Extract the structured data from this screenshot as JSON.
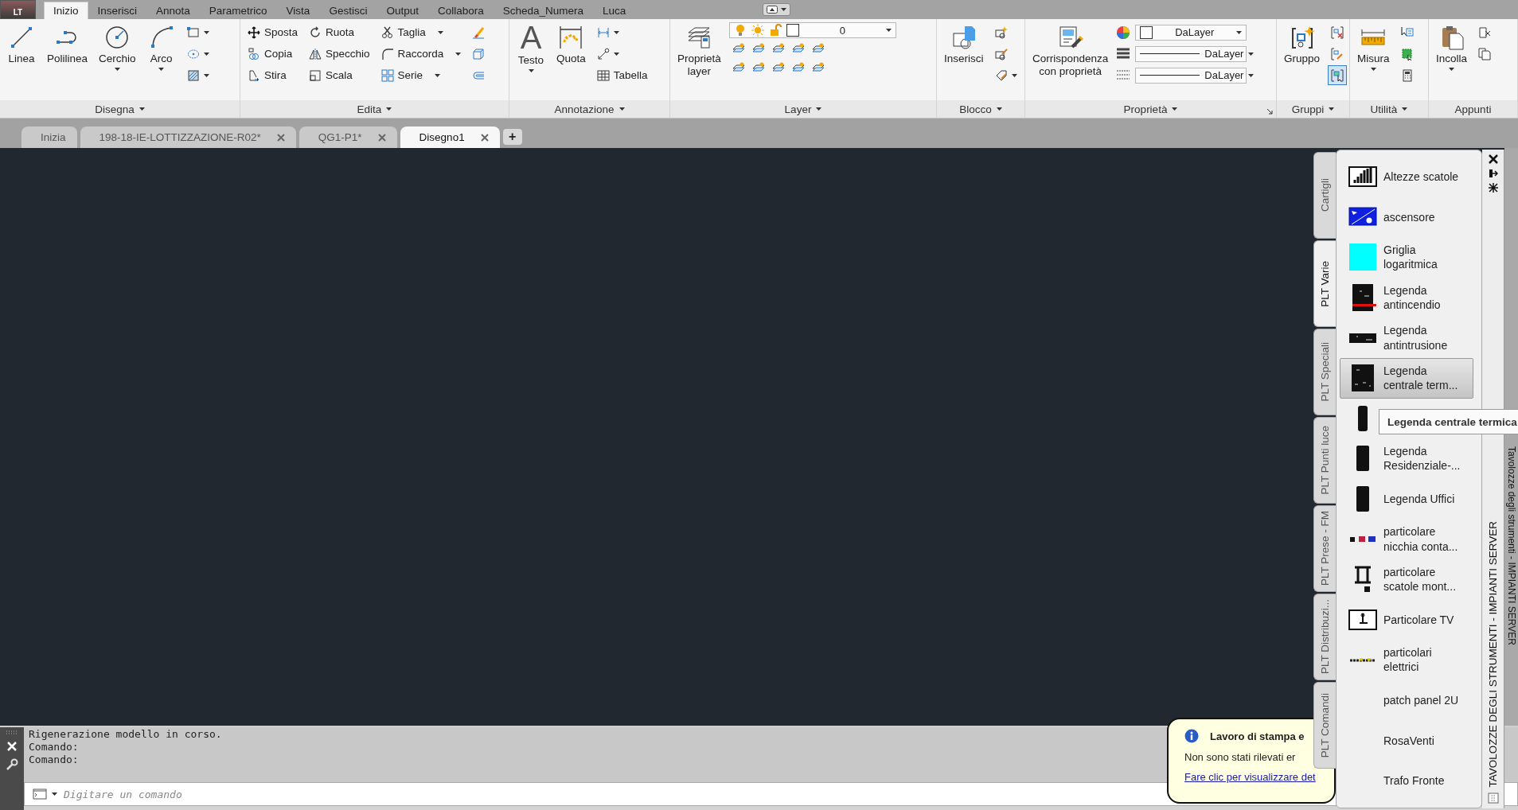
{
  "app_button": {
    "label": "LT"
  },
  "ribbon_tabs": [
    {
      "label": "Inizio",
      "selected": true
    },
    {
      "label": "Inserisci",
      "selected": false
    },
    {
      "label": "Annota",
      "selected": false
    },
    {
      "label": "Parametrico",
      "selected": false
    },
    {
      "label": "Vista",
      "selected": false
    },
    {
      "label": "Gestisci",
      "selected": false
    },
    {
      "label": "Output",
      "selected": false
    },
    {
      "label": "Collabora",
      "selected": false
    },
    {
      "label": "Scheda_Numera",
      "selected": false
    },
    {
      "label": "Luca",
      "selected": false
    }
  ],
  "ribbon_panels": [
    {
      "title": "Disegna",
      "menu": true,
      "launcher": false,
      "columns": [
        [
          {
            "kind": "large",
            "label": "Linea",
            "dropdown": false
          }
        ],
        [
          {
            "kind": "large",
            "label": "Polilinea",
            "dropdown": false
          }
        ],
        [
          {
            "kind": "large",
            "label": "Cerchio",
            "dropdown": true
          }
        ],
        [
          {
            "kind": "large",
            "label": "Arco",
            "dropdown": true
          }
        ],
        [
          {
            "kind": "icon",
            "dropdown": true
          },
          {
            "kind": "icon",
            "dropdown": true
          },
          {
            "kind": "icon",
            "dropdown": true
          }
        ]
      ]
    },
    {
      "title": "Edita",
      "menu": true,
      "launcher": false,
      "columns": [
        [
          {
            "kind": "small",
            "label": "Sposta",
            "dropdown": false
          },
          {
            "kind": "small",
            "label": "Copia",
            "dropdown": false
          },
          {
            "kind": "small",
            "label": "Stira",
            "dropdown": false
          }
        ],
        [
          {
            "kind": "small",
            "label": "Ruota",
            "dropdown": false
          },
          {
            "kind": "small",
            "label": "Specchio",
            "dropdown": false
          },
          {
            "kind": "small",
            "label": "Scala",
            "dropdown": false
          }
        ],
        [
          {
            "kind": "small",
            "label": "Taglia",
            "dropdown": true
          },
          {
            "kind": "small",
            "label": "Raccorda",
            "dropdown": true
          },
          {
            "kind": "small",
            "label": "Serie",
            "dropdown": true
          }
        ],
        [
          {
            "kind": "icon",
            "dropdown": false
          },
          {
            "kind": "icon",
            "dropdown": false
          },
          {
            "kind": "icon",
            "dropdown": false
          }
        ]
      ]
    },
    {
      "title": "Annotazione",
      "menu": true,
      "launcher": false,
      "columns": [
        [
          {
            "kind": "large",
            "label": "Testo",
            "glyph": "A",
            "dropdown": true
          }
        ],
        [
          {
            "kind": "large",
            "label": "Quota",
            "dropdown": false
          }
        ],
        [
          {
            "kind": "icon",
            "dropdown": true
          },
          {
            "kind": "icon",
            "dropdown": true
          },
          {
            "kind": "small",
            "label": "Tabella",
            "dropdown": false
          }
        ]
      ]
    },
    {
      "title": "Layer",
      "menu": true,
      "launcher": false,
      "columns": [
        [
          {
            "kind": "large",
            "label": "Proprietà\nlayer",
            "dropdown": false
          }
        ],
        [
          {
            "kind": "layer-combo",
            "value": "0"
          },
          {
            "kind": "toolrow"
          },
          {
            "kind": "toolrow"
          }
        ]
      ]
    },
    {
      "title": "Blocco",
      "menu": true,
      "launcher": false,
      "columns": [
        [
          {
            "kind": "large",
            "label": "Inserisci",
            "dropdown": false
          }
        ],
        [
          {
            "kind": "icon",
            "dropdown": false
          },
          {
            "kind": "icon",
            "dropdown": false
          },
          {
            "kind": "icon",
            "dropdown": true
          }
        ]
      ]
    },
    {
      "title": "Proprietà",
      "menu": true,
      "launcher": true,
      "columns": [
        [
          {
            "kind": "large",
            "label": "Corrispondenza\ncon proprietà",
            "dropdown": false
          }
        ],
        [
          {
            "kind": "combo",
            "value": "DaLayer"
          },
          {
            "kind": "combo",
            "value": "DaLayer"
          },
          {
            "kind": "combo",
            "value": "DaLayer"
          }
        ]
      ]
    },
    {
      "title": "Gruppi",
      "menu": true,
      "launcher": false,
      "columns": [
        [
          {
            "kind": "large",
            "label": "Gruppo",
            "dropdown": false
          }
        ],
        [
          {
            "kind": "icon",
            "dropdown": false,
            "on": false
          },
          {
            "kind": "icon",
            "dropdown": false,
            "on": false
          },
          {
            "kind": "icon",
            "dropdown": false,
            "on": true
          }
        ]
      ]
    },
    {
      "title": "Utilità",
      "menu": true,
      "launcher": false,
      "columns": [
        [
          {
            "kind": "large",
            "label": "Misura",
            "dropdown": true
          }
        ],
        [
          {
            "kind": "icon",
            "dropdown": false
          },
          {
            "kind": "icon",
            "dropdown": false
          },
          {
            "kind": "icon",
            "dropdown": false
          }
        ]
      ]
    },
    {
      "title": "Appunti",
      "menu": false,
      "launcher": false,
      "columns": [
        [
          {
            "kind": "large",
            "label": "Incolla",
            "dropdown": true
          }
        ],
        [
          {
            "kind": "icon",
            "dropdown": false
          },
          {
            "kind": "icon",
            "dropdown": false
          }
        ]
      ]
    }
  ],
  "doc_tabs": [
    {
      "label": "Inizia",
      "selected": false,
      "closable": false
    },
    {
      "label": "198-18-IE-LOTTIZZAZIONE-R02*",
      "selected": false,
      "closable": true
    },
    {
      "label": "QG1-P1*",
      "selected": false,
      "closable": true
    },
    {
      "label": "Disegno1",
      "selected": true,
      "closable": true
    }
  ],
  "new_tab_button": "+",
  "command_line": {
    "history": [
      "Rigenerazione modello in corso.",
      "Comando:",
      "Comando:"
    ],
    "placeholder": "Digitare un comando"
  },
  "dock": {
    "title": "Tavolozze degli strumenti - IMPIANTI SERVER"
  },
  "palette": {
    "title": "TAVOLOZZE DEGLI STRUMENTI - IMPIANTI SERVER",
    "tabs": [
      {
        "label": "Cartigli",
        "selected": false
      },
      {
        "label": "PLT Varie",
        "selected": true
      },
      {
        "label": "PLT Speciali",
        "selected": false
      },
      {
        "label": "PLT Punti luce",
        "selected": false
      },
      {
        "label": "PLT Prese - FM",
        "selected": false
      },
      {
        "label": "PLT Distribuzi...",
        "selected": false
      },
      {
        "label": "PLT Comandi",
        "selected": false
      }
    ],
    "items": [
      {
        "label": "Altezze scatole",
        "selected": false
      },
      {
        "label": "ascensore",
        "selected": false
      },
      {
        "label": "Griglia logaritmica",
        "selected": false
      },
      {
        "label": "Legenda antincendio",
        "selected": false
      },
      {
        "label": "Legenda antintrusione",
        "selected": false
      },
      {
        "label": "Legenda centrale term...",
        "selected": true
      },
      {
        "selected": false
      },
      {
        "label": "Legenda Residenziale-...",
        "selected": false
      },
      {
        "label": "Legenda Uffici",
        "selected": false
      },
      {
        "label": "particolare nicchia conta...",
        "selected": false
      },
      {
        "label": "particolare scatole mont...",
        "selected": false
      },
      {
        "label": "Particolare TV",
        "selected": false
      },
      {
        "label": "particolari elettrici",
        "selected": false
      },
      {
        "label": "patch panel 2U",
        "selected": false
      },
      {
        "label": "RosaVenti",
        "selected": false
      },
      {
        "label": "Trafo Fronte",
        "selected": false
      }
    ],
    "tooltip": "Legenda centrale termica"
  },
  "notification": {
    "title": "Lavoro di stampa e",
    "message": "Non sono stati rilevati er",
    "link": "Fare clic per visualizzare det"
  }
}
